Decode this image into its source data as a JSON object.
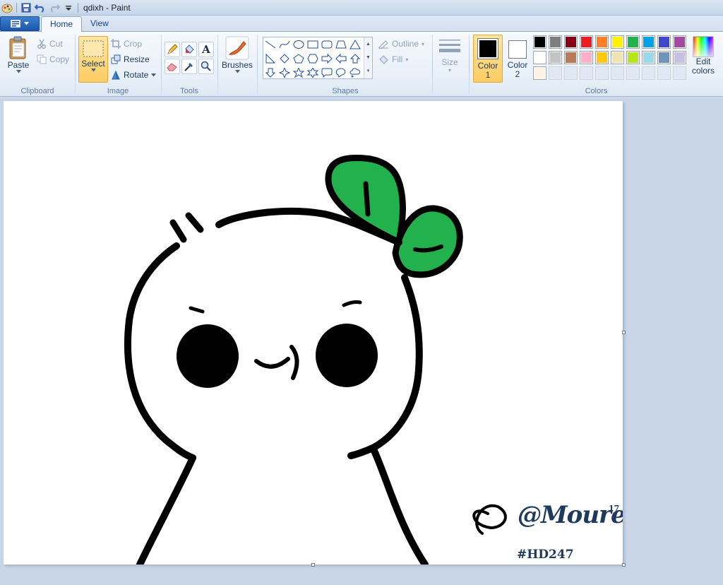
{
  "window": {
    "title": "qdixh - Paint"
  },
  "tabs": [
    {
      "label": "Home",
      "active": true
    },
    {
      "label": "View",
      "active": false
    }
  ],
  "clipboard": {
    "paste": "Paste",
    "cut": "Cut",
    "copy": "Copy",
    "label": "Clipboard"
  },
  "image": {
    "select": "Select",
    "crop": "Crop",
    "resize": "Resize",
    "rotate": "Rotate",
    "label": "Image"
  },
  "tools": {
    "label": "Tools"
  },
  "brushes": {
    "label": "Brushes"
  },
  "shapes": {
    "label": "Shapes",
    "outline": "Outline",
    "fill": "Fill"
  },
  "size": {
    "label": "Size"
  },
  "colors": {
    "label": "Colors",
    "color1": {
      "label1": "Color",
      "label2": "1",
      "value": "#000000"
    },
    "color2": {
      "label1": "Color",
      "label2": "2",
      "value": "#ffffff"
    },
    "edit1": "Edit",
    "edit2": "colors",
    "palette": [
      "#000000",
      "#7f7f7f",
      "#880015",
      "#ed1c24",
      "#ff7f27",
      "#fff200",
      "#22b14c",
      "#00a2e8",
      "#3f48cc",
      "#a349a4",
      "#ffffff",
      "#c3c3c3",
      "#b97a57",
      "#ffaec9",
      "#ffc90e",
      "#efe4b0",
      "#b5e61d",
      "#99d9ea",
      "#7092be",
      "#c8bfe7",
      "#fdf2e4",
      "#dfe8f3",
      "#dfe8f3",
      "#dfe8f3",
      "#dfe8f3",
      "#dfe8f3",
      "#dfe8f3",
      "#dfe8f3",
      "#dfe8f3",
      "#dfe8f3"
    ]
  },
  "drawing": {
    "signature": "@Moure",
    "superscript": "17",
    "tag": "#HD247",
    "leaf_color": "#22b14c",
    "stroke_color": "#000000"
  }
}
